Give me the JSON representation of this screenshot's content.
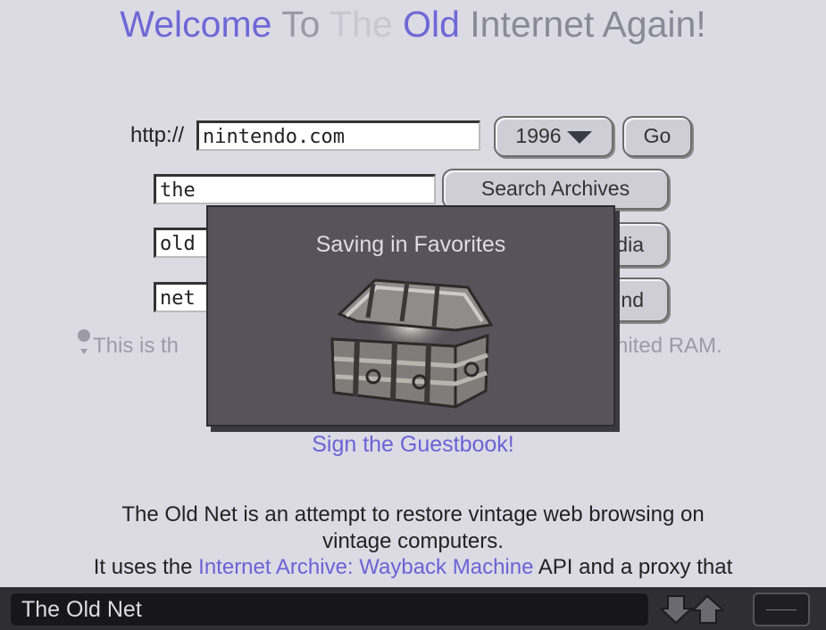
{
  "header": {
    "title_parts": [
      {
        "text": "Welcome",
        "color": "#6e68d6"
      },
      {
        "text": " To ",
        "color": "#9b9aa6"
      },
      {
        "text": "The",
        "color": "#c9c7d0"
      },
      {
        "text": " Old ",
        "color": "#6e68d6"
      },
      {
        "text": "Internet Again!",
        "color": "#8a8a96"
      }
    ]
  },
  "form": {
    "http_label": "http://",
    "url_value": "nintendo.com",
    "year_value": "1996",
    "go_label": "Go",
    "search_value": "the",
    "search_button_label": "Search Archives",
    "field2_value": "old",
    "button2_label_partial": "dia",
    "field3_value": "net",
    "button3_label_partial": "ind"
  },
  "notice": {
    "left_text": "This is th",
    "right_text": "nited RAM."
  },
  "modal": {
    "title": "Saving in Favorites",
    "icon": "treasure-chest-icon"
  },
  "guestbook_link": "Sign the Guestbook!",
  "description": {
    "line1": "The Old Net is an attempt to restore vintage web browsing on",
    "line2": "vintage computers.",
    "line3_pre": "It uses the ",
    "line3_link": "Internet Archive: Wayback Machine",
    "line3_post": " API and a proxy that"
  },
  "status_bar": {
    "page_title": "The Old Net",
    "back_icon": "down-arrow-icon",
    "forward_icon": "up-arrow-icon",
    "menu_icon": "menu-icon"
  },
  "colors": {
    "background": "#dcdbe4",
    "link": "#6a63d6",
    "modal": "#56535a",
    "bar": "#2f2f33"
  }
}
